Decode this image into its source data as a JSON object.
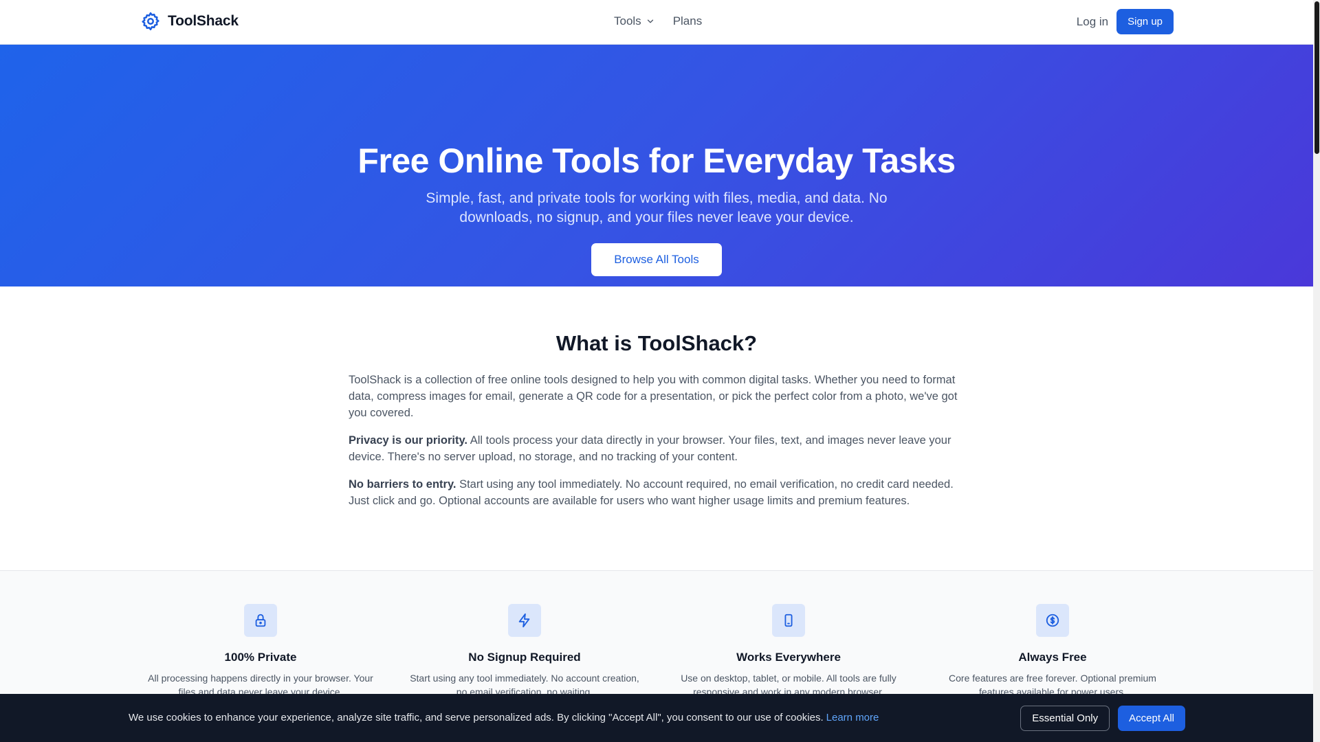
{
  "colors": {
    "primary": "#1d5fe0",
    "hero_gradient_start": "#1f63ea",
    "hero_gradient_end": "#4a38d9",
    "cookie_bg": "#111827",
    "icon_box_bg": "#dbe6fb"
  },
  "header": {
    "brand": {
      "name": "ToolShack",
      "icon": "gear-icon"
    },
    "nav": [
      {
        "label": "Tools",
        "has_dropdown": true
      },
      {
        "label": "Plans",
        "has_dropdown": false
      }
    ],
    "login_label": "Log in",
    "signup_label": "Sign up"
  },
  "hero": {
    "title": "Free Online Tools for Everyday Tasks",
    "subtitle": "Simple, fast, and private tools for working with files, media, and data. No downloads, no signup, and your files never leave your device.",
    "cta_label": "Browse All Tools"
  },
  "about": {
    "title": "What is ToolShack?",
    "paragraphs": [
      {
        "lead": "",
        "text": "ToolShack is a collection of free online tools designed to help you with common digital tasks. Whether you need to format data, compress images for email, generate a QR code for a presentation, or pick the perfect color from a photo, we've got you covered."
      },
      {
        "lead": "Privacy is our priority.",
        "text": " All tools process your data directly in your browser. Your files, text, and images never leave your device. There's no server upload, no storage, and no tracking of your content."
      },
      {
        "lead": "No barriers to entry.",
        "text": " Start using any tool immediately. No account required, no email verification, no credit card needed. Just click and go. Optional accounts are available for users who want higher usage limits and premium features."
      }
    ]
  },
  "features": [
    {
      "icon": "lock-icon",
      "title": "100% Private",
      "desc": "All processing happens directly in your browser. Your files and data never leave your device."
    },
    {
      "icon": "lightning-icon",
      "title": "No Signup Required",
      "desc": "Start using any tool immediately. No account creation, no email verification, no waiting."
    },
    {
      "icon": "phone-icon",
      "title": "Works Everywhere",
      "desc": "Use on desktop, tablet, or mobile. All tools are fully responsive and work in any modern browser."
    },
    {
      "icon": "dollar-icon",
      "title": "Always Free",
      "desc": "Core features are free forever. Optional premium features available for power users."
    }
  ],
  "cookie": {
    "text": "We use cookies to enhance your experience, analyze site traffic, and serve personalized ads. By clicking \"Accept All\", you consent to our use of cookies.",
    "link_label": "Learn more",
    "essential_label": "Essential Only",
    "accept_label": "Accept All"
  }
}
